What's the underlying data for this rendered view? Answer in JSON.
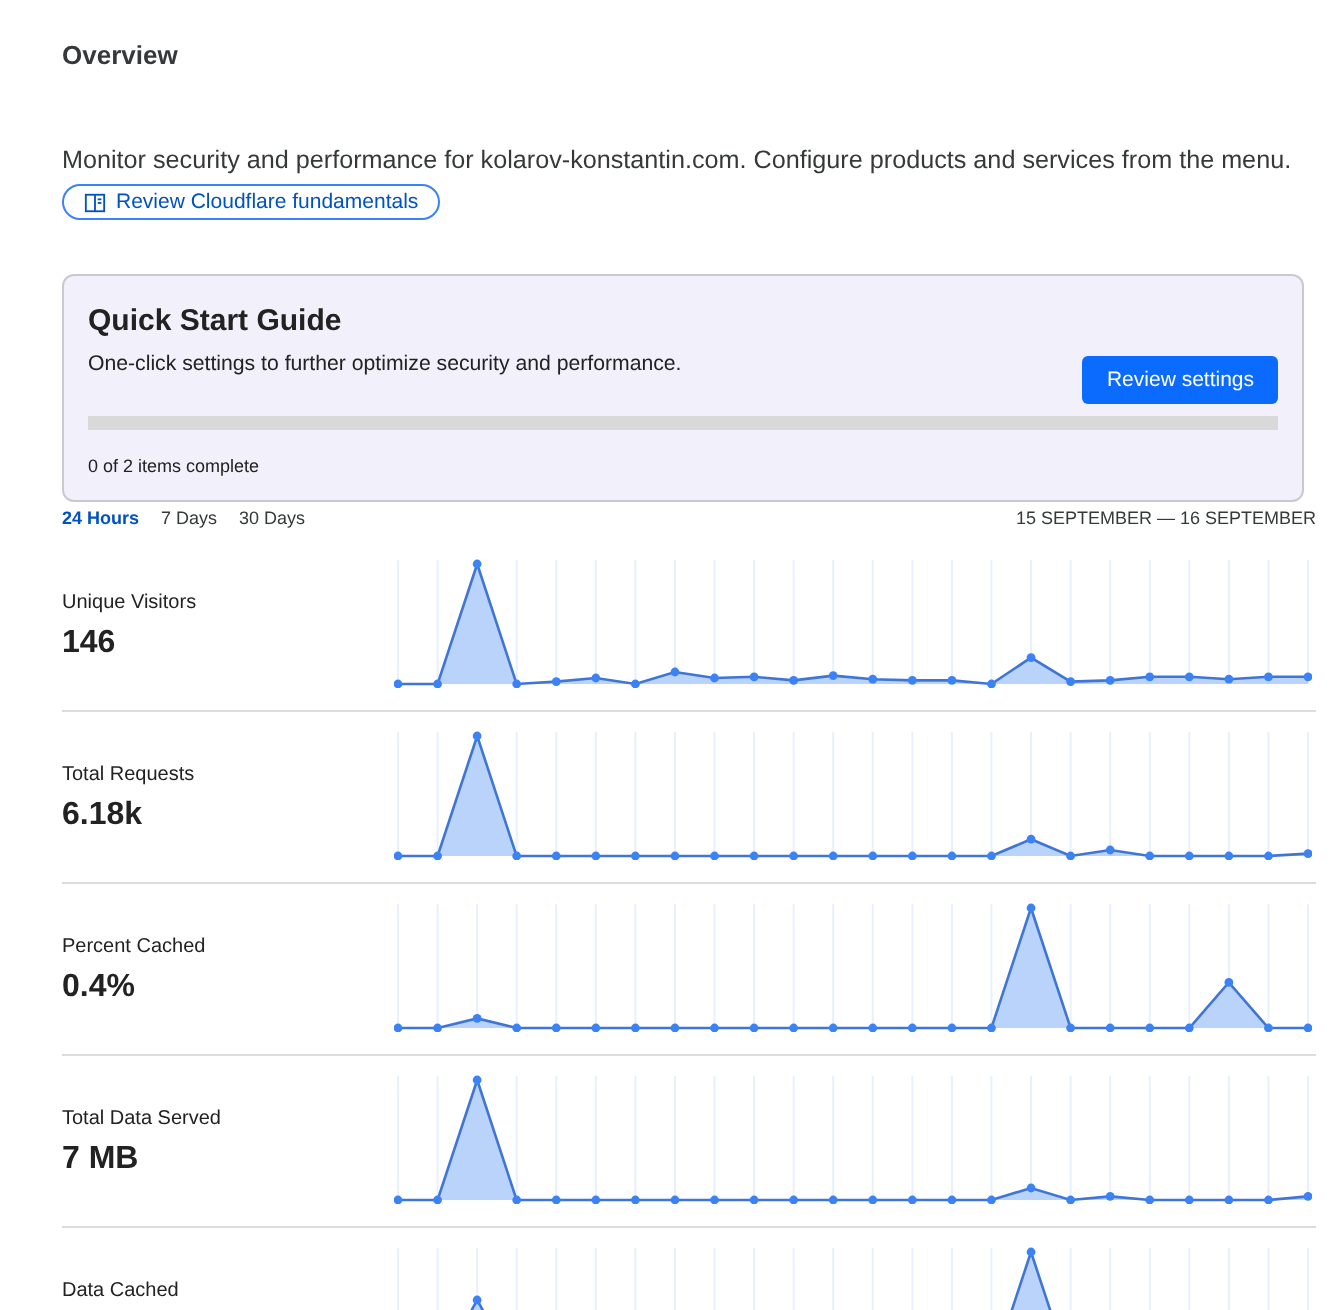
{
  "header": {
    "title": "Overview",
    "description": "Monitor security and performance for kolarov-konstantin.com. Configure products and services from the menu.",
    "link": "Review Cloudflare fundamentals"
  },
  "quick_start": {
    "title": "Quick Start Guide",
    "subtitle": "One-click settings to further optimize security and performance.",
    "button": "Review settings",
    "progress": {
      "level": 0
    },
    "status": "0 of 2 items complete"
  },
  "time_tabs": [
    {
      "label": "24 Hours",
      "selected": true
    },
    {
      "label": "7 Days",
      "selected": false
    },
    {
      "label": "30 Days",
      "selected": false
    }
  ],
  "date_range": "15 SEPTEMBER — 16 SEPTEMBER",
  "metrics": [
    {
      "label": "Unique Visitors",
      "value": "146"
    },
    {
      "label": "Total Requests",
      "value": "6.18k"
    },
    {
      "label": "Percent Cached",
      "value": "0.4%"
    },
    {
      "label": "Total Data Served",
      "value": "7 MB"
    },
    {
      "label": "Data Cached"
    }
  ]
}
